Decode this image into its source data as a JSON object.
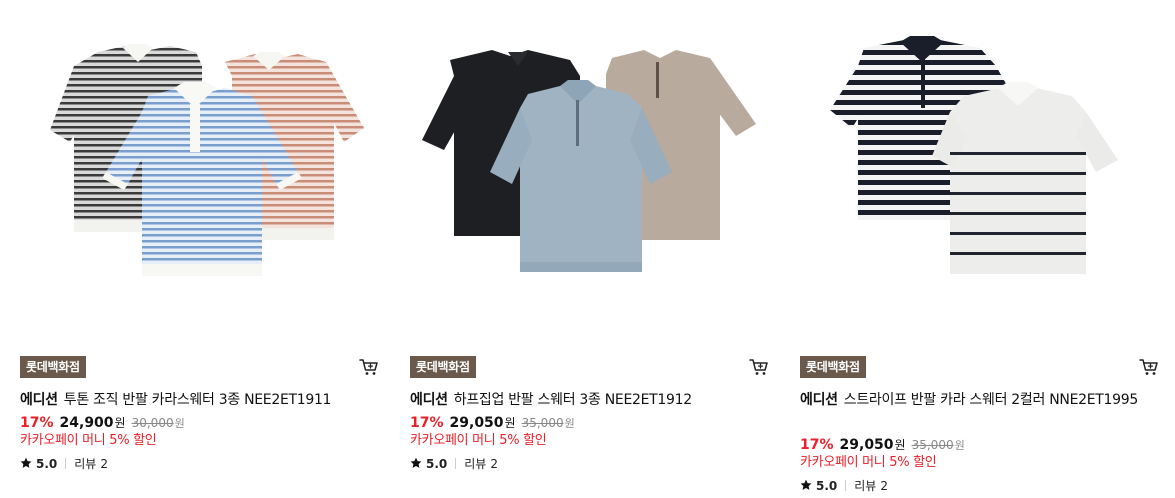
{
  "products": [
    {
      "store_badge": "롯데백화점",
      "brand": "에디션",
      "name": "투톤 조직 반팔 카라스웨터 3종 NEE2ET1911",
      "discount_rate": "17%",
      "sale_price": "24,900",
      "sale_unit": "원",
      "original_price": "30,000",
      "original_unit": "원",
      "promo": "카카오페이 머니 5% 할인",
      "rating": "5.0",
      "review_label": "리뷰",
      "review_count": "2",
      "image_alt": "three striped knit polo shirts in grey, peach and blue"
    },
    {
      "store_badge": "롯데백화점",
      "brand": "에디션",
      "name": "하프집업 반팔 스웨터 3종 NEE2ET1912",
      "discount_rate": "17%",
      "sale_price": "29,050",
      "sale_unit": "원",
      "original_price": "35,000",
      "original_unit": "원",
      "promo": "카카오페이 머니 5% 할인",
      "rating": "5.0",
      "review_label": "리뷰",
      "review_count": "2",
      "image_alt": "three half-zip knit polo shirts in black, beige and light blue"
    },
    {
      "store_badge": "롯데백화점",
      "brand": "에디션",
      "name": "스트라이프 반팔 카라 스웨터 2컬러 NNE2ET1995",
      "discount_rate": "17%",
      "sale_price": "29,050",
      "sale_unit": "원",
      "original_price": "35,000",
      "original_unit": "원",
      "promo": "카카오페이 머니 5% 할인",
      "rating": "5.0",
      "review_label": "리뷰",
      "review_count": "2",
      "image_alt": "two striped knit collar sweaters in navy and white"
    }
  ],
  "icons": {
    "cart": "cart-icon",
    "star": "star-icon"
  },
  "colors": {
    "badge_bg": "#6b5a4c",
    "accent_red": "#e8202a",
    "strike_grey": "#888888"
  }
}
